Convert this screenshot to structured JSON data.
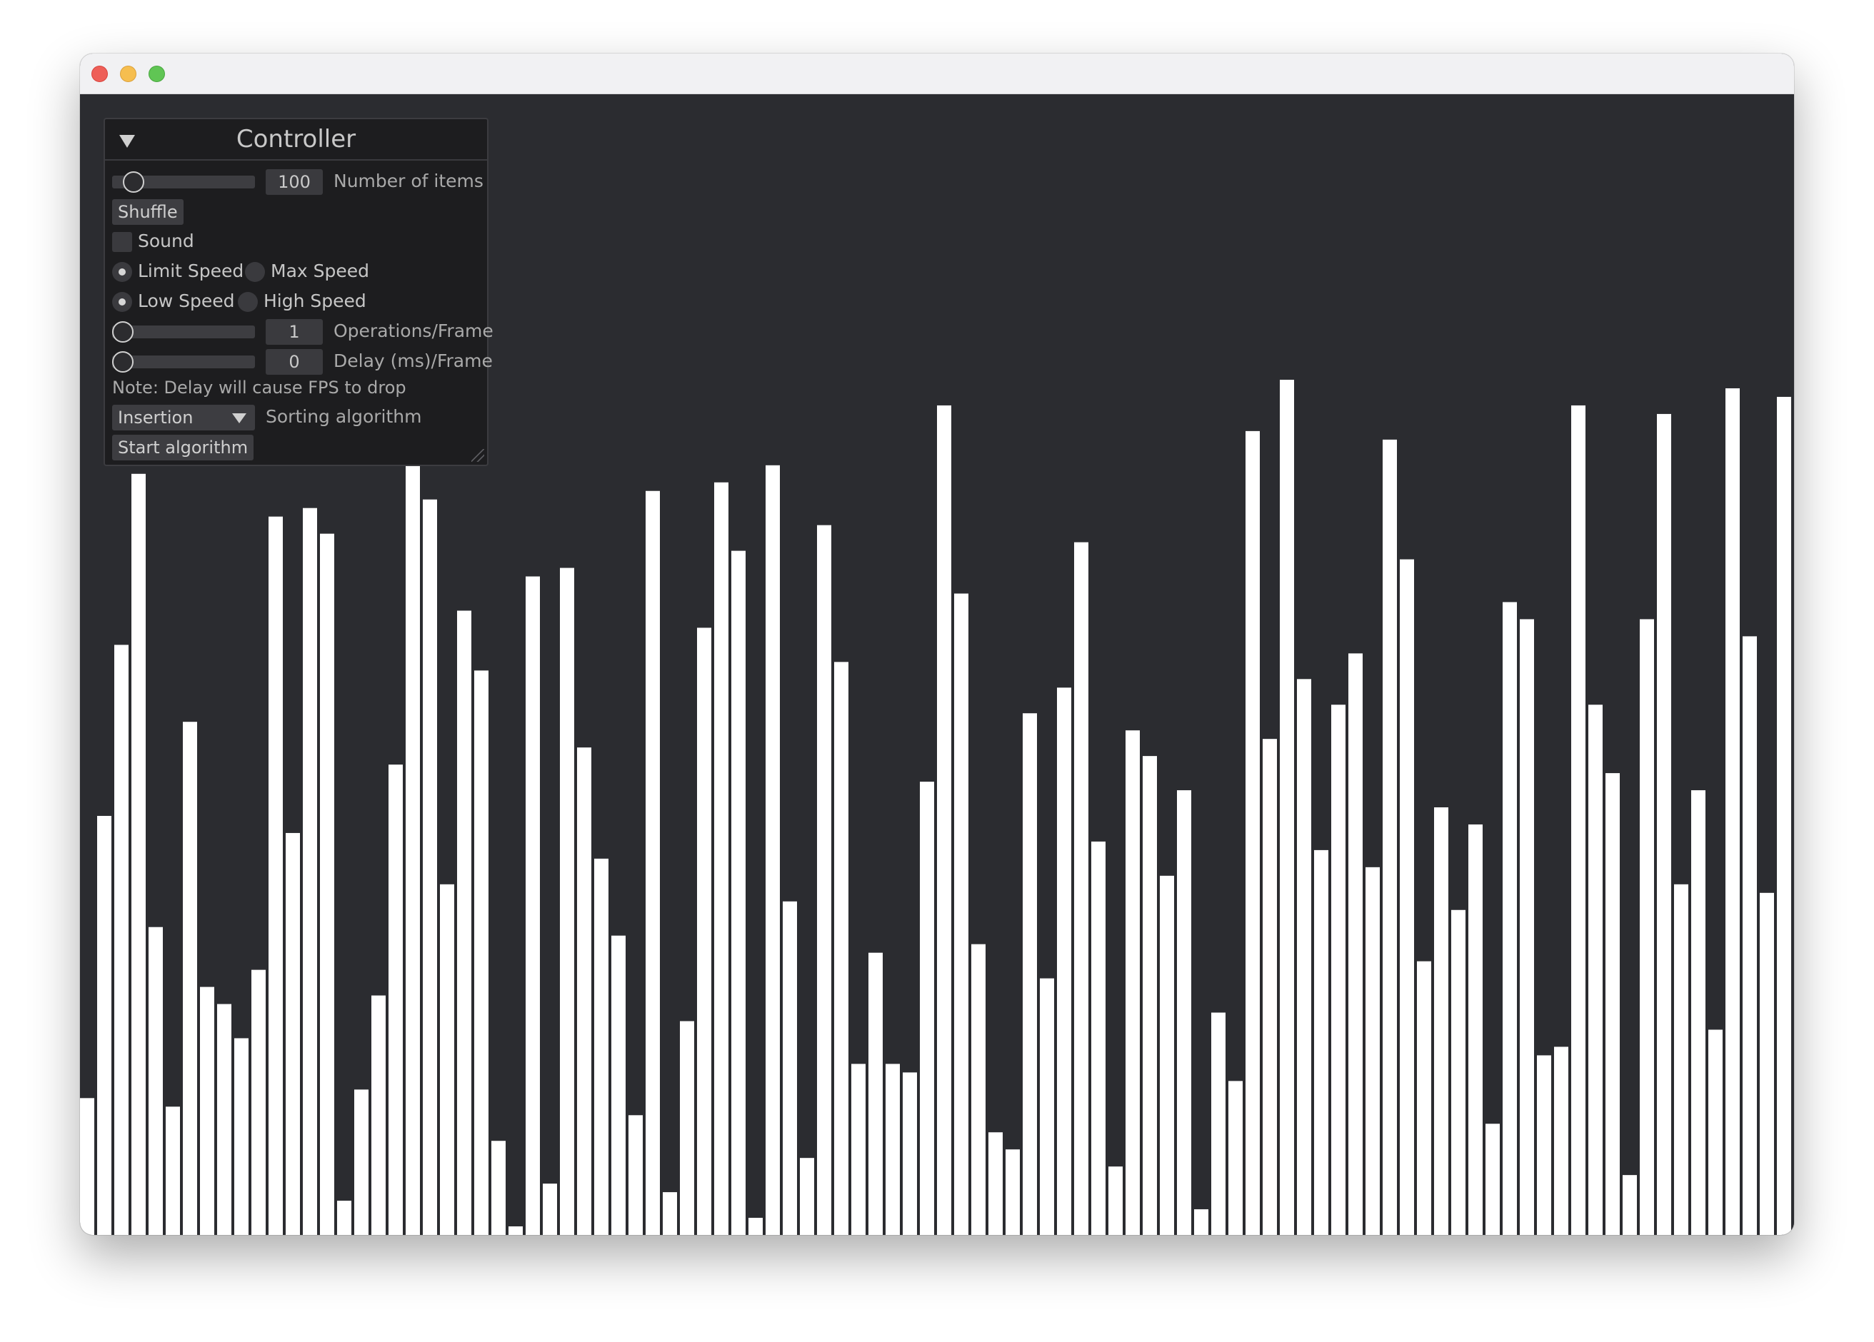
{
  "window": {
    "traffic_lights": [
      "close",
      "minimize",
      "maximize"
    ]
  },
  "controller": {
    "title": "Controller",
    "items_value": "100",
    "items_label": "Number of items",
    "items_slider_level": 0.1,
    "shuffle_label": "Shuffle",
    "sound_label": "Sound",
    "sound_checked": false,
    "limit_speed_label": "Limit Speed",
    "max_speed_label": "Max Speed",
    "speed_mode": "Limit Speed",
    "low_speed_label": "Low Speed",
    "high_speed_label": "High Speed",
    "speed_level": "Low Speed",
    "ops_value": "1",
    "ops_label": "Operations/Frame",
    "delay_value": "0",
    "delay_label": "Delay (ms)/Frame",
    "note": "Note: Delay will cause FPS to drop",
    "algorithm_value": "Insertion",
    "algorithm_label": "Sorting algorithm",
    "start_label": "Start algorithm"
  },
  "chart_data": {
    "type": "bar",
    "bar_color": "#ffffff",
    "background": "#2b2c30",
    "ylim": [
      0,
      100
    ],
    "values": [
      16,
      49,
      69,
      89,
      36,
      15,
      60,
      29,
      27,
      23,
      31,
      84,
      47,
      85,
      82,
      4,
      17,
      28,
      55,
      92,
      86,
      41,
      73,
      66,
      11,
      1,
      77,
      6,
      78,
      57,
      44,
      35,
      14,
      87,
      5,
      25,
      71,
      88,
      80,
      2,
      90,
      39,
      9,
      83,
      67,
      20,
      33,
      20,
      19,
      53,
      97,
      75,
      34,
      12,
      10,
      61,
      30,
      64,
      81,
      46,
      8,
      59,
      56,
      42,
      52,
      3,
      26,
      18,
      94,
      58,
      100,
      65,
      45,
      62,
      68,
      43,
      93,
      79,
      32,
      50,
      38,
      48,
      13,
      74,
      72,
      21,
      22,
      97,
      62,
      54,
      7,
      72,
      96,
      41,
      52,
      24,
      99,
      70,
      40,
      98
    ]
  }
}
